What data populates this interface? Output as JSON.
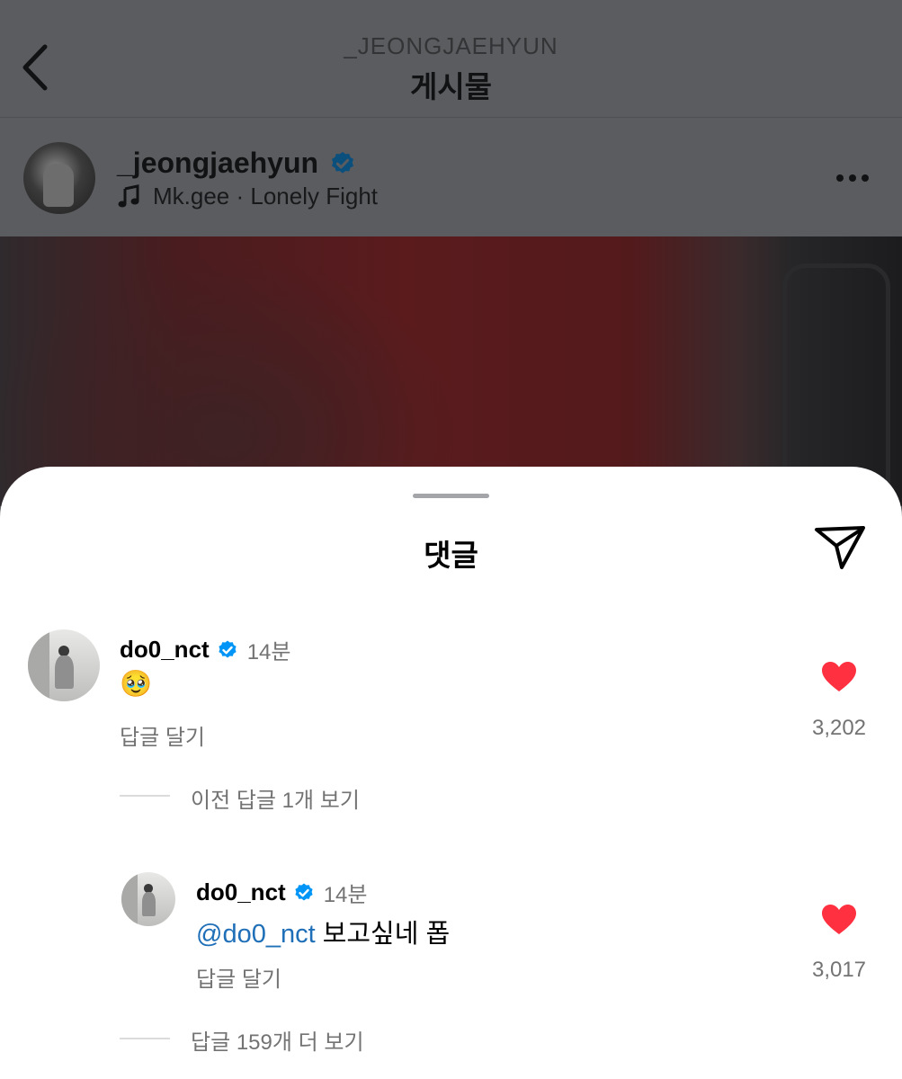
{
  "header": {
    "username": "_JEONGJAEHYUN",
    "title": "게시물"
  },
  "post": {
    "author": "_jeongjaehyun",
    "music": "Mk.gee · Lonely Fight"
  },
  "comments_sheet": {
    "title": "댓글",
    "comments": [
      {
        "username": "do0_nct",
        "time": "14분",
        "text": "🥹",
        "reply_label": "답글 달기",
        "likes": "3,202",
        "view_replies": "이전 답글 1개 보기"
      }
    ],
    "replies": [
      {
        "username": "do0_nct",
        "time": "14분",
        "mention": "@do0_nct",
        "text": " 보고싶네 폽",
        "reply_label": "답글 달기",
        "likes": "3,017"
      }
    ],
    "more_replies": "답글 159개 더 보기"
  },
  "colors": {
    "verified": "#0095f6",
    "heart": "#ff3040",
    "mention": "#1e6fb8"
  },
  "icons": [
    "back-icon",
    "verified-icon",
    "music-note-icon",
    "more-icon",
    "share-icon",
    "heart-icon"
  ]
}
